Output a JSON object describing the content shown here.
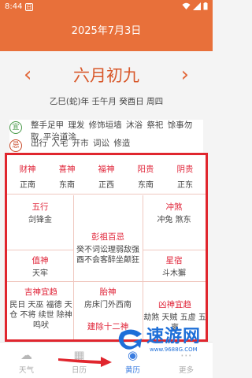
{
  "status_bar": {
    "time": "8:44",
    "app_icon": "日"
  },
  "header": {
    "date": "2025年7月3日",
    "background": "#e8703a"
  },
  "lunar": {
    "prev_icon": "‹",
    "next_icon": "›",
    "date": "六月初九",
    "ganzhi": "乙巳(蛇)年  壬午月  癸酉日  周四"
  },
  "yiji": {
    "yi_badge": "宜",
    "yi": "整手足甲  理发  修饰垣墙  沐浴  祭祀  馀事勿取  平治道涂",
    "ji_badge": "忌",
    "ji": "出行  入宅  开市  词讼  修造"
  },
  "gods": [
    {
      "name": "财神",
      "dir": "正南"
    },
    {
      "name": "喜神",
      "dir": "东南"
    },
    {
      "name": "福神",
      "dir": "正西"
    },
    {
      "name": "阳贵",
      "dir": "东南"
    },
    {
      "name": "阴贵",
      "dir": "正东"
    }
  ],
  "grid": {
    "wuxing_title": "五行",
    "wuxing": "剑锋金",
    "pengzu_title": "彭祖百忌",
    "pengzu": "癸不词讼理弱敌强 酉不会客醉坐颠狂",
    "chongsha_title": "冲煞",
    "chongsha": "冲兔  煞东",
    "zhishen_title": "值神",
    "zhishen": "天牢",
    "xingxiu_title": "星宿",
    "xingxiu": "斗木獬",
    "jishen_title": "吉神宜趋",
    "jishen": "民日  天巫  福德  天仓  不将  续世  除神  鸣吠",
    "taishen_title": "胎神",
    "taishen": "房床门外西南",
    "xiongsha_title": "凶神宜趋",
    "xiongsha": "劫煞  天贼  五虚  五离",
    "jianchu_title": "建除十二神"
  },
  "tabs": [
    {
      "label": "天气",
      "icon": "☁"
    },
    {
      "label": "日历",
      "icon": "▦"
    },
    {
      "label": "黄历",
      "icon": "◉"
    },
    {
      "label": "更多",
      "icon": "⋯"
    }
  ],
  "watermark": {
    "logo": "速游网",
    "url": "www.9688G.COM"
  },
  "colors": {
    "accent": "#e8703a",
    "red": "#e0263a",
    "tab_active": "#3b7de0",
    "annotation": "#e0262e"
  }
}
